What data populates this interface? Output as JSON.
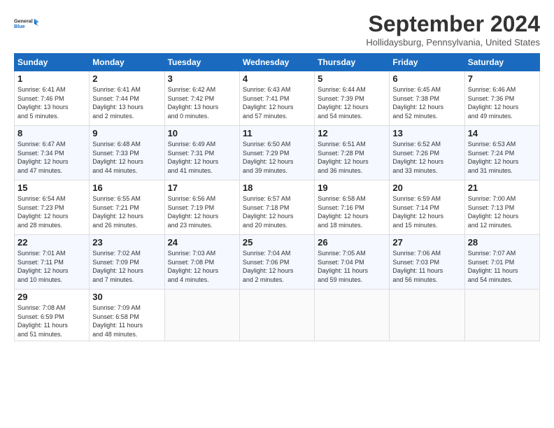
{
  "header": {
    "logo_line1": "General",
    "logo_line2": "Blue",
    "month": "September 2024",
    "location": "Hollidaysburg, Pennsylvania, United States"
  },
  "days_of_week": [
    "Sunday",
    "Monday",
    "Tuesday",
    "Wednesday",
    "Thursday",
    "Friday",
    "Saturday"
  ],
  "weeks": [
    [
      {
        "day": 1,
        "info": "Sunrise: 6:41 AM\nSunset: 7:46 PM\nDaylight: 13 hours\nand 5 minutes."
      },
      {
        "day": 2,
        "info": "Sunrise: 6:41 AM\nSunset: 7:44 PM\nDaylight: 13 hours\nand 2 minutes."
      },
      {
        "day": 3,
        "info": "Sunrise: 6:42 AM\nSunset: 7:42 PM\nDaylight: 13 hours\nand 0 minutes."
      },
      {
        "day": 4,
        "info": "Sunrise: 6:43 AM\nSunset: 7:41 PM\nDaylight: 12 hours\nand 57 minutes."
      },
      {
        "day": 5,
        "info": "Sunrise: 6:44 AM\nSunset: 7:39 PM\nDaylight: 12 hours\nand 54 minutes."
      },
      {
        "day": 6,
        "info": "Sunrise: 6:45 AM\nSunset: 7:38 PM\nDaylight: 12 hours\nand 52 minutes."
      },
      {
        "day": 7,
        "info": "Sunrise: 6:46 AM\nSunset: 7:36 PM\nDaylight: 12 hours\nand 49 minutes."
      }
    ],
    [
      {
        "day": 8,
        "info": "Sunrise: 6:47 AM\nSunset: 7:34 PM\nDaylight: 12 hours\nand 47 minutes."
      },
      {
        "day": 9,
        "info": "Sunrise: 6:48 AM\nSunset: 7:33 PM\nDaylight: 12 hours\nand 44 minutes."
      },
      {
        "day": 10,
        "info": "Sunrise: 6:49 AM\nSunset: 7:31 PM\nDaylight: 12 hours\nand 41 minutes."
      },
      {
        "day": 11,
        "info": "Sunrise: 6:50 AM\nSunset: 7:29 PM\nDaylight: 12 hours\nand 39 minutes."
      },
      {
        "day": 12,
        "info": "Sunrise: 6:51 AM\nSunset: 7:28 PM\nDaylight: 12 hours\nand 36 minutes."
      },
      {
        "day": 13,
        "info": "Sunrise: 6:52 AM\nSunset: 7:26 PM\nDaylight: 12 hours\nand 33 minutes."
      },
      {
        "day": 14,
        "info": "Sunrise: 6:53 AM\nSunset: 7:24 PM\nDaylight: 12 hours\nand 31 minutes."
      }
    ],
    [
      {
        "day": 15,
        "info": "Sunrise: 6:54 AM\nSunset: 7:23 PM\nDaylight: 12 hours\nand 28 minutes."
      },
      {
        "day": 16,
        "info": "Sunrise: 6:55 AM\nSunset: 7:21 PM\nDaylight: 12 hours\nand 26 minutes."
      },
      {
        "day": 17,
        "info": "Sunrise: 6:56 AM\nSunset: 7:19 PM\nDaylight: 12 hours\nand 23 minutes."
      },
      {
        "day": 18,
        "info": "Sunrise: 6:57 AM\nSunset: 7:18 PM\nDaylight: 12 hours\nand 20 minutes."
      },
      {
        "day": 19,
        "info": "Sunrise: 6:58 AM\nSunset: 7:16 PM\nDaylight: 12 hours\nand 18 minutes."
      },
      {
        "day": 20,
        "info": "Sunrise: 6:59 AM\nSunset: 7:14 PM\nDaylight: 12 hours\nand 15 minutes."
      },
      {
        "day": 21,
        "info": "Sunrise: 7:00 AM\nSunset: 7:13 PM\nDaylight: 12 hours\nand 12 minutes."
      }
    ],
    [
      {
        "day": 22,
        "info": "Sunrise: 7:01 AM\nSunset: 7:11 PM\nDaylight: 12 hours\nand 10 minutes."
      },
      {
        "day": 23,
        "info": "Sunrise: 7:02 AM\nSunset: 7:09 PM\nDaylight: 12 hours\nand 7 minutes."
      },
      {
        "day": 24,
        "info": "Sunrise: 7:03 AM\nSunset: 7:08 PM\nDaylight: 12 hours\nand 4 minutes."
      },
      {
        "day": 25,
        "info": "Sunrise: 7:04 AM\nSunset: 7:06 PM\nDaylight: 12 hours\nand 2 minutes."
      },
      {
        "day": 26,
        "info": "Sunrise: 7:05 AM\nSunset: 7:04 PM\nDaylight: 11 hours\nand 59 minutes."
      },
      {
        "day": 27,
        "info": "Sunrise: 7:06 AM\nSunset: 7:03 PM\nDaylight: 11 hours\nand 56 minutes."
      },
      {
        "day": 28,
        "info": "Sunrise: 7:07 AM\nSunset: 7:01 PM\nDaylight: 11 hours\nand 54 minutes."
      }
    ],
    [
      {
        "day": 29,
        "info": "Sunrise: 7:08 AM\nSunset: 6:59 PM\nDaylight: 11 hours\nand 51 minutes."
      },
      {
        "day": 30,
        "info": "Sunrise: 7:09 AM\nSunset: 6:58 PM\nDaylight: 11 hours\nand 48 minutes."
      },
      null,
      null,
      null,
      null,
      null
    ]
  ]
}
